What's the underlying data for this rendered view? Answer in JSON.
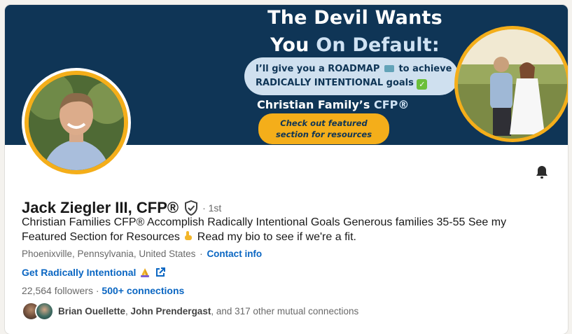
{
  "banner": {
    "title_line1": "The Devil Wants",
    "title_line2_a": "You ",
    "title_line2_b": "On Default:",
    "pill_line1_a": "I’ll give you a ROADMAP",
    "pill_line1_b": "to achieve",
    "pill_line2": "RADICALLY INTENTIONAL goals",
    "subtitle_a": "Christian Family’s ",
    "subtitle_b": "CFP®",
    "featured_line1": "Check out featured",
    "featured_line2": "section for resources"
  },
  "profile": {
    "name": "Jack Ziegler III, CFP®",
    "degree": "· 1st",
    "headline_a": "Christian Families CFP® Accomplish Radically Intentional Goals Generous families 35-55 See my Featured Section for Resources",
    "headline_b": "Read my bio to see if we're a fit.",
    "location": "Phoenixville, Pennsylvania, United States",
    "location_sep": "·",
    "contact_info": "Contact info",
    "website_label": "Get Radically Intentional",
    "followers": "22,564 followers",
    "stats_sep": "·",
    "connections": "500+ connections",
    "mutual_name1": "Brian Ouellette",
    "mutual_sep": ", ",
    "mutual_name2": "John Prendergast",
    "mutual_rest": ", and 317 other mutual connections"
  },
  "icons": {
    "bell": "bell-icon",
    "verified": "verified-shield-icon",
    "external_link": "external-link-icon",
    "praying_hands": "praying-hands-emoji",
    "pointing_down": "pointing-down-emoji",
    "map": "map-emoji",
    "check": "check-mark-emoji"
  },
  "colors": {
    "banner_bg": "#0f3556",
    "accent_gold": "#f4ae1a",
    "link_blue": "#0a66c2"
  }
}
